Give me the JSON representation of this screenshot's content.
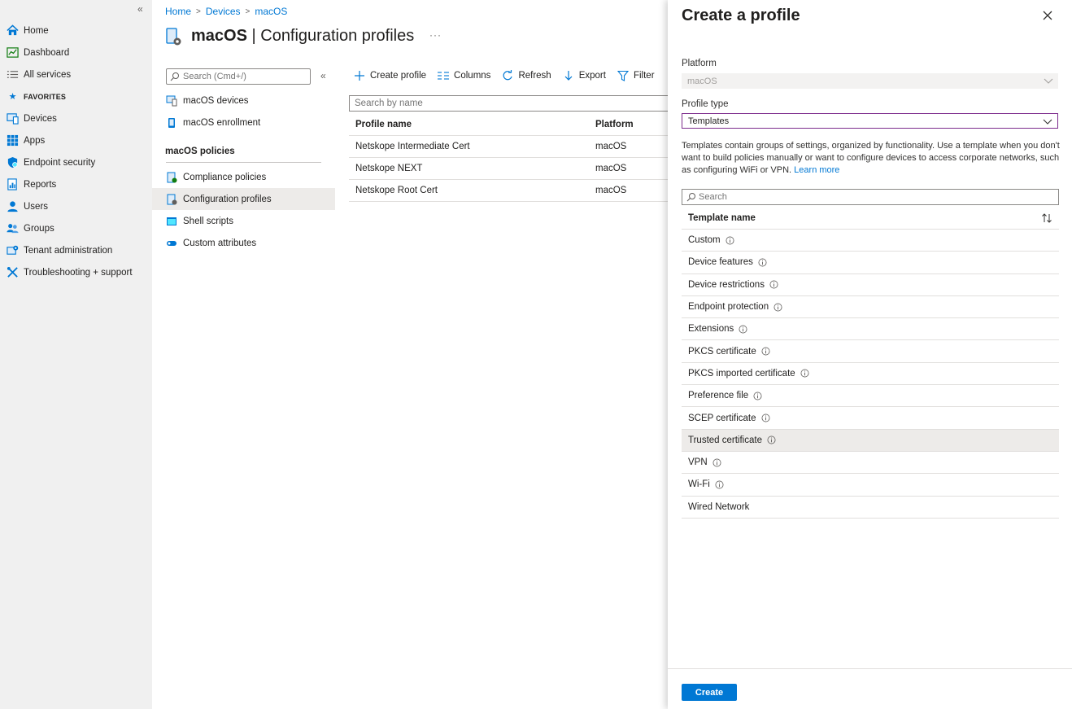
{
  "leftnav": {
    "collapse_glyph": "«",
    "items": [
      {
        "label": "Home",
        "icon": "home-icon"
      },
      {
        "label": "Dashboard",
        "icon": "dashboard-icon"
      },
      {
        "label": "All services",
        "icon": "list-icon"
      },
      {
        "label": "FAVORITES",
        "icon": "star-icon"
      },
      {
        "label": "Devices",
        "icon": "devices-icon"
      },
      {
        "label": "Apps",
        "icon": "apps-icon"
      },
      {
        "label": "Endpoint security",
        "icon": "shield-icon"
      },
      {
        "label": "Reports",
        "icon": "reports-icon"
      },
      {
        "label": "Users",
        "icon": "user-icon"
      },
      {
        "label": "Groups",
        "icon": "groups-icon"
      },
      {
        "label": "Tenant administration",
        "icon": "tenant-admin-icon"
      },
      {
        "label": "Troubleshooting + support",
        "icon": "troubleshoot-icon"
      }
    ]
  },
  "breadcrumb": [
    "Home",
    "Devices",
    "macOS"
  ],
  "page": {
    "title_bold": "macOS",
    "title_rest": " | Configuration profiles",
    "more": "···"
  },
  "menu": {
    "search_placeholder": "Search (Cmd+/)",
    "collapse_glyph": "«",
    "items_top": [
      "macOS devices",
      "macOS enrollment"
    ],
    "section_heading": "macOS policies",
    "items_policies": [
      "Compliance policies",
      "Configuration profiles",
      "Shell scripts",
      "Custom attributes"
    ],
    "active_item": "Configuration profiles"
  },
  "toolbar": {
    "create": "Create profile",
    "columns": "Columns",
    "refresh": "Refresh",
    "export": "Export",
    "filter": "Filter"
  },
  "grid": {
    "search_placeholder": "Search by name",
    "columns": [
      "Profile name",
      "Platform"
    ],
    "rows": [
      [
        "Netskope Intermediate Cert",
        "macOS"
      ],
      [
        "Netskope NEXT",
        "macOS"
      ],
      [
        "Netskope Root Cert",
        "macOS"
      ]
    ]
  },
  "panel": {
    "title": "Create a profile",
    "platform_label": "Platform",
    "platform_value": "macOS",
    "profile_type_label": "Profile type",
    "profile_type_value": "Templates",
    "description": "Templates contain groups of settings, organized by functionality. Use a template when you don't want to build policies manually or want to configure devices to access corporate networks, such as configuring WiFi or VPN.",
    "learn_more": "Learn more",
    "search_placeholder": "Search",
    "table_header": "Template name",
    "templates": [
      {
        "name": "Custom",
        "info": true
      },
      {
        "name": "Device features",
        "info": true
      },
      {
        "name": "Device restrictions",
        "info": true
      },
      {
        "name": "Endpoint protection",
        "info": true
      },
      {
        "name": "Extensions",
        "info": true
      },
      {
        "name": "PKCS certificate",
        "info": true
      },
      {
        "name": "PKCS imported certificate",
        "info": true
      },
      {
        "name": "Preference file",
        "info": true
      },
      {
        "name": "SCEP certificate",
        "info": true
      },
      {
        "name": "Trusted certificate",
        "info": true
      },
      {
        "name": "VPN",
        "info": true
      },
      {
        "name": "Wi-Fi",
        "info": true
      },
      {
        "name": "Wired Network",
        "info": false
      }
    ],
    "highlighted_template": "Trusted certificate",
    "create_button": "Create"
  },
  "colors": {
    "accent": "#0078d4",
    "focus_border": "#7c2b8c",
    "nav_bg": "#f0f0f0"
  }
}
